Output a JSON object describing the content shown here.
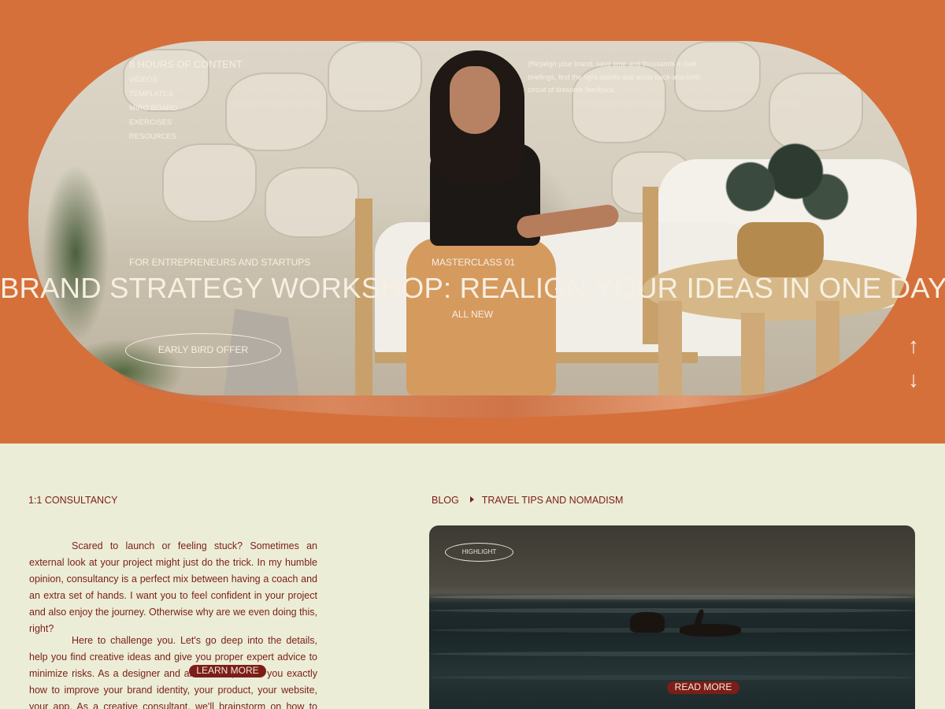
{
  "hero": {
    "nav_title": "8 HOURS OF CONTENT",
    "nav_items": [
      "VIDEOS",
      "TEMPLATES",
      "MIRO BOARD",
      "EXERCISES",
      "RESOURCES"
    ],
    "blurb": "(Re)align your brand, save time and thousands in bad briefings, find the right talents and avoid back-and-forth circuit of tiresome feedback.",
    "tag": "FOR ENTREPRENEURS AND STARTUPS",
    "kicker": "MASTERCLASS 01",
    "title": "BRAND STRATEGY WORKSHOP: REALIGN YOUR IDEAS IN ONE DAY",
    "subtitle": "ALL NEW",
    "cta": "EARLY BIRD OFFER",
    "arrow_up": "↑",
    "arrow_down": "↓"
  },
  "consultancy": {
    "label": "1:1 CONSULTANCY",
    "paragraph1": "Scared to launch or feeling stuck? Sometimes an external look at your project might just do the trick. In my humble opinion, consultancy is a perfect mix between having a coach and an extra set of hands. I want you to feel confident in your project and also enjoy the journey. Otherwise why are we even doing this, right?",
    "paragraph2": "Here to challenge you. Let's go deep into the details, help you find creative ideas and give you proper expert advice to minimize risks. As a designer and art director, I'll tell you exactly how to improve your brand identity, your product, your website, your app. As a creative consultant, we'll brainstorm on how to make",
    "learn_more": "LEARN MORE"
  },
  "blog": {
    "crumb_root": "BLOG",
    "crumb_current": "TRAVEL TIPS AND NOMADISM",
    "highlight": "HIGHLIGHT",
    "read_more": "READ MORE"
  },
  "colors": {
    "accent": "#d5703b",
    "ink": "#7b1e19",
    "cream": "#ecedd6"
  }
}
